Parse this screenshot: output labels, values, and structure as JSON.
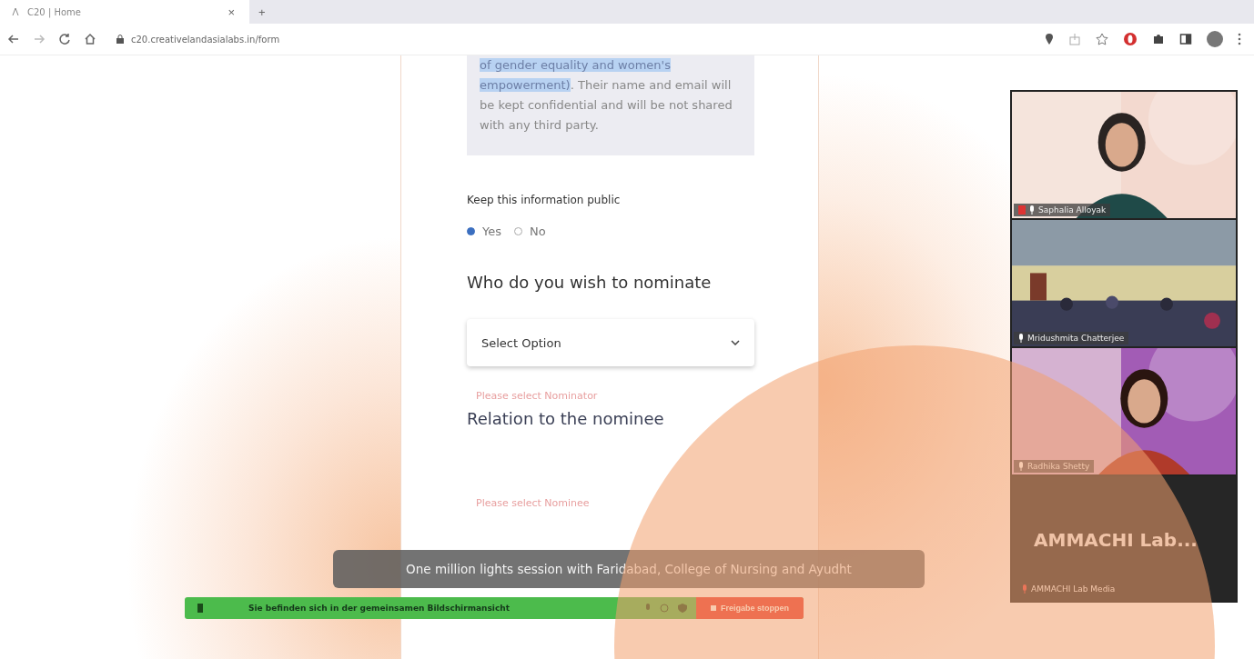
{
  "browser": {
    "tab_title": "C20 | Home",
    "tab_close": "×",
    "new_tab": "+",
    "url": "c20.creativelandasialabs.in/form"
  },
  "form": {
    "notice": {
      "highlighted": "of gender equality and women's empowerment)",
      "rest": ". Their name and email will be kept confidential and will be not shared with any third party."
    },
    "public_label": "Keep this information public",
    "public_options": [
      {
        "label": "Yes",
        "selected": true
      },
      {
        "label": "No",
        "selected": false
      }
    ],
    "nominate_heading": "Who do you wish to nominate",
    "nominate_select": {
      "placeholder": "Select Option"
    },
    "nominator_error": "Please select Nominator",
    "relation_heading": "Relation to the nominee",
    "nominee_error": "Please select Nominee"
  },
  "caption": "One million lights session with Faridabad, College of Nursing and Ayudht",
  "share_bar": {
    "message": "Sie befinden sich in der gemeinsamen Bildschirmansicht",
    "stop_button": "Freigabe stoppen"
  },
  "participants": [
    {
      "name": "Saphalia Alloyak",
      "kind": "picture",
      "muted": true
    },
    {
      "name": "Mridushmita Chatterjee",
      "kind": "picture",
      "muted": false
    },
    {
      "name": "Radhika Shetty",
      "kind": "picture",
      "muted": false
    },
    {
      "name": "AMMACHI Lab Media",
      "kind": "tile",
      "tile_text": "AMMACHI  Lab...",
      "muted": true
    }
  ]
}
